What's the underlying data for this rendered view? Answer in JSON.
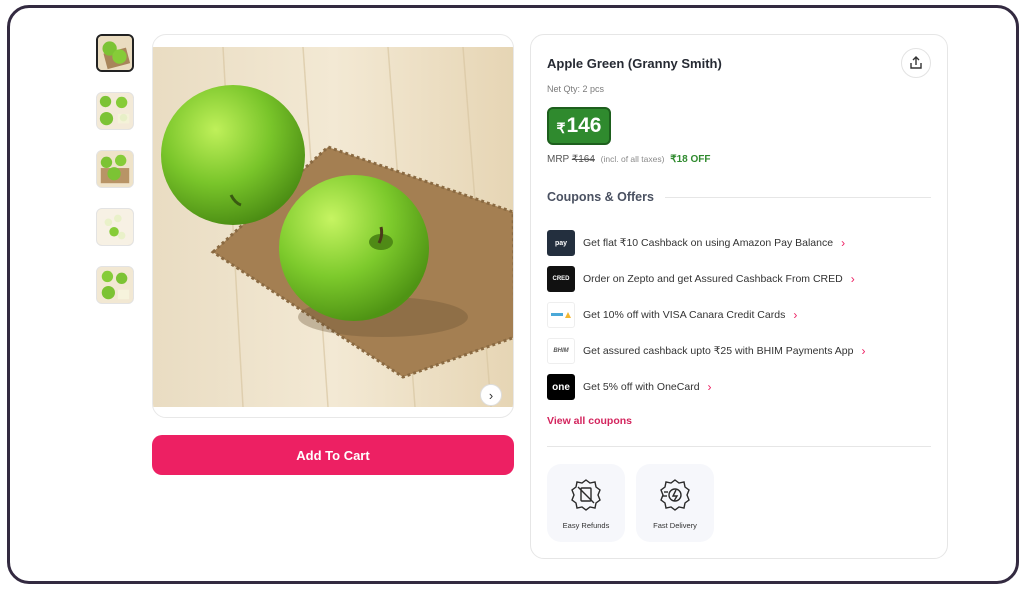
{
  "product": {
    "title": "Apple Green (Granny Smith)",
    "net_qty": "Net Qty: 2 pcs",
    "price_currency": "₹",
    "price": "146",
    "mrp_label": "MRP",
    "mrp_value": "₹164",
    "tax_note": "(incl. of all taxes)",
    "discount": "₹18 OFF"
  },
  "gallery": {
    "thumbnail_count": 5,
    "active_index": 0
  },
  "actions": {
    "add_to_cart": "Add To Cart"
  },
  "coupons": {
    "heading": "Coupons & Offers",
    "items": [
      {
        "text": "Get flat ₹10 Cashback on using Amazon Pay Balance",
        "logo": "pay",
        "logo_bg": "#232f3e"
      },
      {
        "text": "Order on Zepto and get Assured Cashback From CRED",
        "logo": "CRED",
        "logo_bg": "#111111"
      },
      {
        "text": "Get 10% off with VISA Canara Credit Cards",
        "logo": "",
        "logo_bg": "#ffffff"
      },
      {
        "text": "Get assured cashback upto ₹25 with BHIM Payments App",
        "logo": "BHIM",
        "logo_bg": "#ffffff"
      },
      {
        "text": "Get 5% off with OneCard",
        "logo": "one",
        "logo_bg": "#000000"
      }
    ],
    "view_all": "View all coupons"
  },
  "features": [
    {
      "label": "Easy Refunds",
      "icon": "refund-badge-icon"
    },
    {
      "label": "Fast Delivery",
      "icon": "fast-delivery-badge-icon"
    }
  ],
  "colors": {
    "accent": "#ed2063",
    "price_green": "#2f8a2e"
  }
}
